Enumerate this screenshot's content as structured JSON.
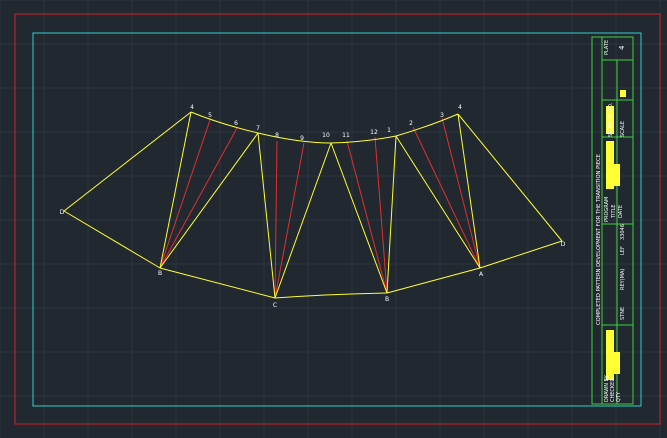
{
  "colors": {
    "background": "#212830",
    "grid": "#2c3440",
    "outer_border": "#d81f2a",
    "inner_border": "#2fd0d0",
    "title_block": "#3ad13a",
    "pattern_line": "#ffff33",
    "fold_line": "#e0302e",
    "label": "#ffffff"
  },
  "pattern": {
    "end_points": {
      "left": "D",
      "right": "D"
    },
    "bottom_vertices": [
      "B",
      "C",
      "B",
      "A"
    ],
    "top_numbers_left": [
      "4",
      "5",
      "6",
      "7",
      "8",
      "9",
      "10",
      "11",
      "12"
    ],
    "top_numbers_right": [
      "1",
      "2",
      "3",
      "4"
    ]
  },
  "title_block": {
    "title": "COMPLETED PATTERN DEVELOPMENT FOR THE TRANSITION PIECE",
    "plate_label": "PLATE",
    "plate_number": "4",
    "student_no_label": "STUDENT NO.",
    "scale_label": "SCALE",
    "program_label": "PROGRAM",
    "title_label": "TITLE",
    "date_label": "DATE",
    "rows": [
      "STNE",
      "REY(MA)",
      "LEF",
      "33046"
    ],
    "drawn_by_label": "DRAWN BY",
    "checked_label": "CHECKED",
    "qty_label": "QTY"
  }
}
